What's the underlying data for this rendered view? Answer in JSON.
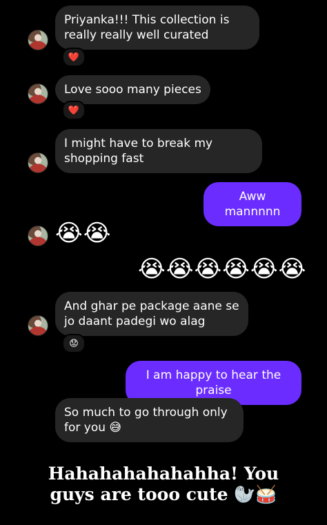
{
  "messages": {
    "m1": {
      "text": "Priyanka!!! This collection is really really well curated",
      "reaction": "❤️"
    },
    "m2": {
      "text": "Love sooo many pieces",
      "reaction": "❤️"
    },
    "m3": {
      "text": "I might have to break my shopping fast"
    },
    "m4": {
      "text": "Aww mannnnn"
    },
    "m5": {
      "text": "😭😭"
    },
    "m6": {
      "text": "😭😭😭😭😭😭"
    },
    "m7": {
      "text": "And ghar pe package aane se jo daant padegi wo alag",
      "reaction": "😟"
    },
    "m8": {
      "text": "I am happy to hear the praise"
    },
    "m9": {
      "text": "So much to go through only for you 😅"
    }
  },
  "caption": {
    "line1": "Hahahahahahahha! You",
    "line2": "guys are tooo cute 🦭🥁"
  },
  "colors": {
    "background": "#000000",
    "incoming_bubble": "#262626",
    "outgoing_bubble": "#6b2dff"
  }
}
